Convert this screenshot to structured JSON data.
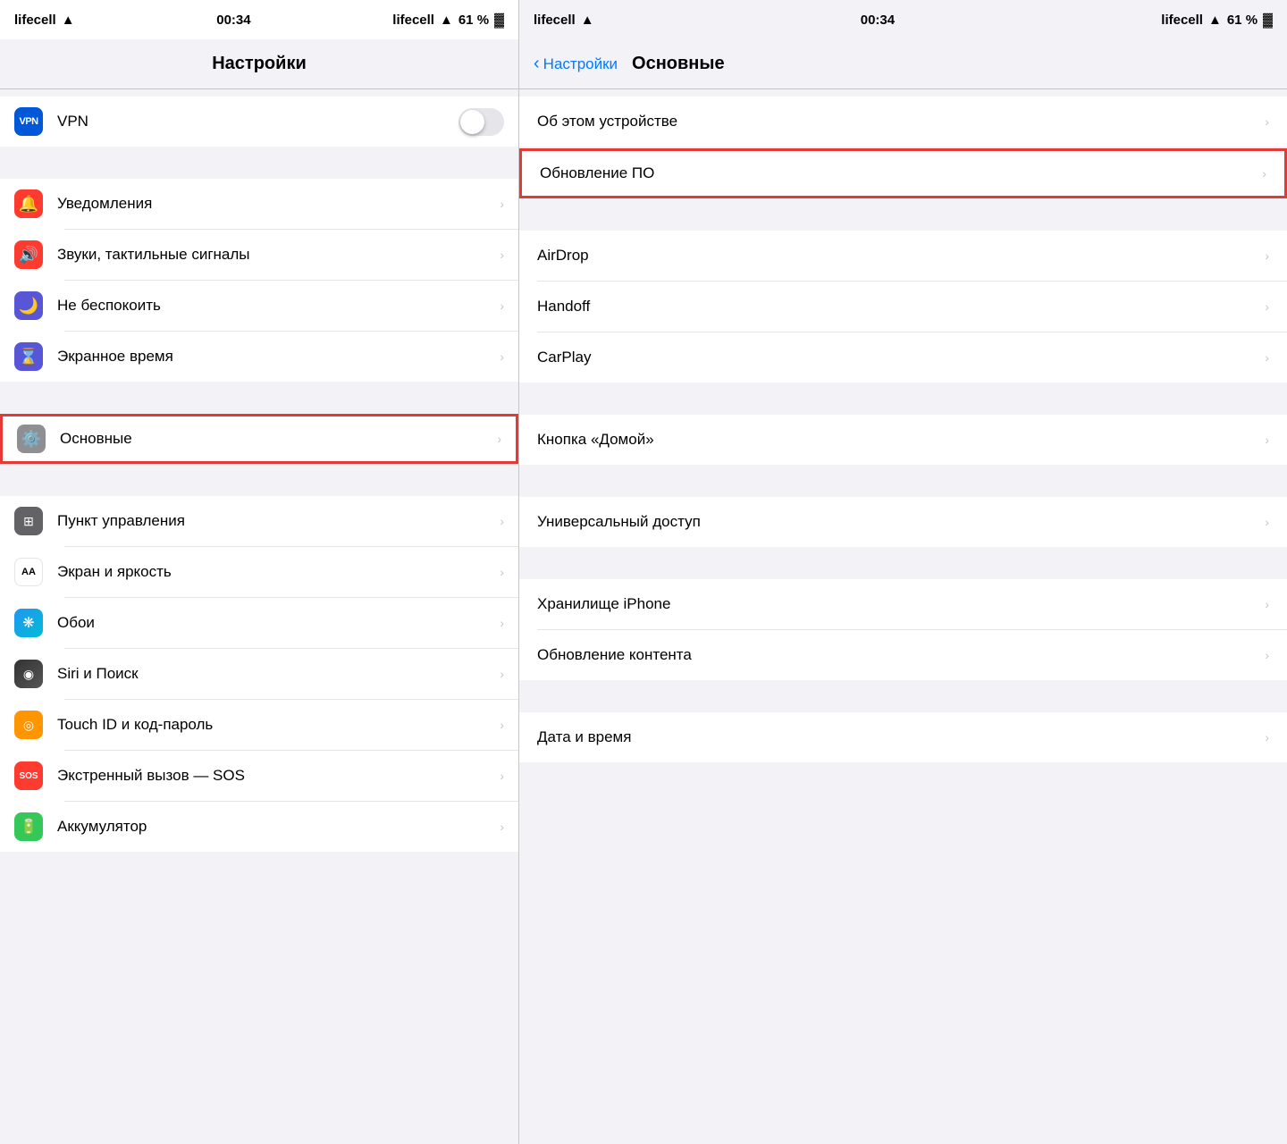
{
  "left": {
    "statusBar": {
      "carrier": "lifecell",
      "wifi": "wifi",
      "time": "00:34",
      "battery": "61 %"
    },
    "navTitle": "Настройки",
    "vpn": {
      "label": "VPN"
    },
    "sections": [
      {
        "id": "notifications-group",
        "items": [
          {
            "id": "notifications",
            "label": "Уведомления",
            "icon": "🔔",
            "iconBg": "#ff3b30",
            "chevron": true
          },
          {
            "id": "sounds",
            "label": "Звуки, тактильные сигналы",
            "icon": "🔊",
            "iconBg": "#ff3b30",
            "chevron": true
          },
          {
            "id": "donotdisturb",
            "label": "Не беспокоить",
            "icon": "🌙",
            "iconBg": "#5856d6",
            "chevron": true
          },
          {
            "id": "screentime",
            "label": "Экранное время",
            "icon": "⏳",
            "iconBg": "#5856d6",
            "chevron": true
          }
        ]
      },
      {
        "id": "general-group",
        "items": [
          {
            "id": "general",
            "label": "Основные",
            "icon": "⚙️",
            "iconBg": "#8e8e93",
            "chevron": true,
            "highlighted": true
          }
        ]
      },
      {
        "id": "more-group",
        "items": [
          {
            "id": "controlcenter",
            "label": "Пункт управления",
            "icon": "⊞",
            "iconBg": "#636366",
            "chevron": true
          },
          {
            "id": "displaybrightness",
            "label": "Экран и яркость",
            "icon": "AA",
            "iconBg": "#fff",
            "iconColor": "#000",
            "chevron": true
          },
          {
            "id": "wallpaper",
            "label": "Обои",
            "icon": "❋",
            "iconBg": "#2196f3",
            "chevron": true
          },
          {
            "id": "siri",
            "label": "Siri и Поиск",
            "icon": "◉",
            "iconBg": "#333",
            "chevron": true
          },
          {
            "id": "touchid",
            "label": "Touch ID и код-пароль",
            "icon": "◎",
            "iconBg": "#ff9500",
            "chevron": true
          },
          {
            "id": "sos",
            "label": "Экстренный вызов — SOS",
            "icon": "SOS",
            "iconBg": "#ff3b30",
            "chevron": true
          },
          {
            "id": "battery",
            "label": "Аккумулятор",
            "icon": "🔋",
            "iconBg": "#34c759",
            "chevron": true
          }
        ]
      }
    ]
  },
  "right": {
    "statusBar": {
      "carrier": "lifecell",
      "wifi": "wifi",
      "time": "00:34",
      "battery": "61 %"
    },
    "backLabel": "Настройки",
    "navTitle": "Основные",
    "sections": [
      {
        "id": "top-group",
        "items": [
          {
            "id": "about",
            "label": "Об этом устройстве",
            "chevron": true
          }
        ]
      },
      {
        "id": "update-group",
        "items": [
          {
            "id": "softwareupdate",
            "label": "Обновление ПО",
            "chevron": true,
            "highlighted": true
          }
        ]
      },
      {
        "id": "airdrop-group",
        "items": [
          {
            "id": "airdrop",
            "label": "AirDrop",
            "chevron": true
          },
          {
            "id": "handoff",
            "label": "Handoff",
            "chevron": true
          },
          {
            "id": "carplay",
            "label": "CarPlay",
            "chevron": true
          }
        ]
      },
      {
        "id": "home-group",
        "items": [
          {
            "id": "homebutton",
            "label": "Кнопка «Домой»",
            "chevron": true
          }
        ]
      },
      {
        "id": "accessibility-group",
        "items": [
          {
            "id": "accessibility",
            "label": "Универсальный доступ",
            "chevron": true
          }
        ]
      },
      {
        "id": "storage-group",
        "items": [
          {
            "id": "storage",
            "label": "Хранилище iPhone",
            "chevron": true
          },
          {
            "id": "contentupdate",
            "label": "Обновление контента",
            "chevron": true
          }
        ]
      },
      {
        "id": "datetime-group",
        "items": [
          {
            "id": "datetime",
            "label": "Дата и время",
            "chevron": true
          }
        ]
      }
    ]
  },
  "icons": {
    "chevron": "›",
    "back_chevron": "‹",
    "wifi": "wifi",
    "battery": "battery"
  }
}
